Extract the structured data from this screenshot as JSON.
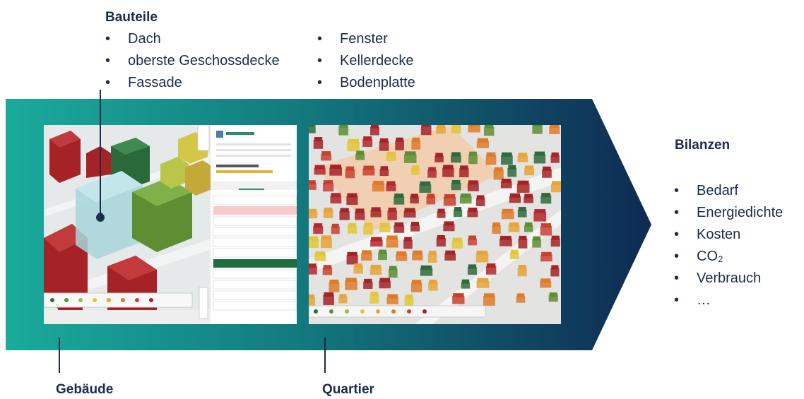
{
  "bauteile": {
    "title": "Bauteile",
    "col1": [
      "Dach",
      "oberste Geschossdecke",
      "Fassade"
    ],
    "col2": [
      "Fenster",
      "Kellerdecke",
      "Bodenplatte"
    ]
  },
  "bilanzen": {
    "title": "Bilanzen",
    "items": [
      "Bedarf",
      "Energiedichte",
      "Kosten",
      "CO₂",
      "Verbrauch",
      "…"
    ]
  },
  "labels": {
    "gebaeude": "Gebäude",
    "quartier": "Quartier"
  },
  "colors": {
    "arrow_start": "#1aab9b",
    "arrow_end": "#0e2a52",
    "text": "#1b2c4c",
    "bldg_red": "#b3262b",
    "bldg_darkgreen": "#2f6b3a",
    "bldg_green": "#6a9a3a",
    "bldg_yellow": "#e3c53a",
    "bldg_orange": "#e07a2a",
    "highlight_blue": "#9fd6dc"
  }
}
